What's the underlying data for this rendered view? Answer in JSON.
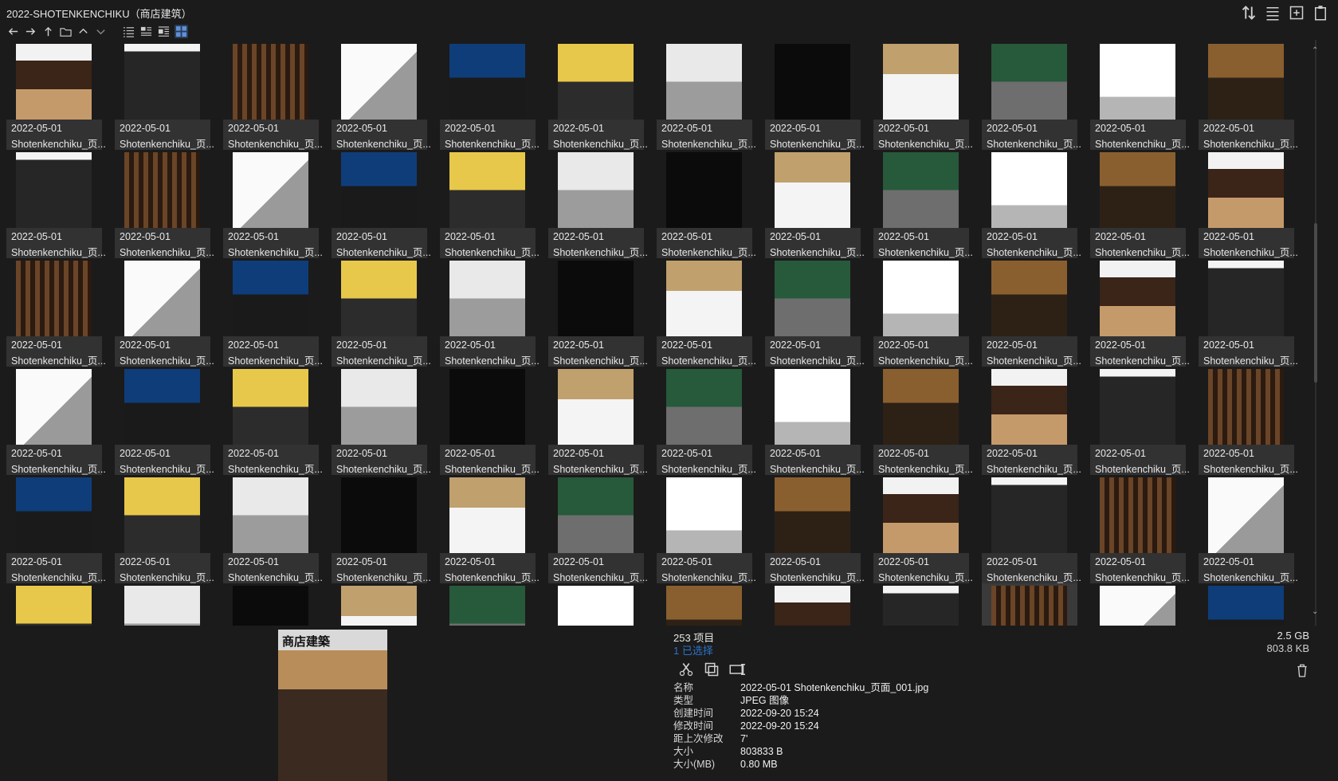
{
  "window": {
    "title": "2022-SHOTENKENCHIKU（商店建筑）"
  },
  "toolbar": {
    "nav": [
      {
        "name": "back-arrow-icon"
      },
      {
        "name": "forward-arrow-icon"
      },
      {
        "name": "up-arrow-icon"
      },
      {
        "name": "folder-icon"
      },
      {
        "name": "chevron-up-icon"
      },
      {
        "name": "chevron-down-icon"
      }
    ],
    "views": [
      {
        "name": "list-view-icon"
      },
      {
        "name": "detail-view-icon"
      },
      {
        "name": "details-pane-icon"
      },
      {
        "name": "grid-view-icon"
      }
    ],
    "active_view": "grid-view-icon"
  },
  "topright_icons": [
    "sort-icon",
    "columns-icon",
    "new-window-icon",
    "clipboard-icon"
  ],
  "grid": {
    "rows": 6,
    "cols": 12,
    "selected_index": 69,
    "cell_date": "2022-05-01",
    "cell_name": "Shotenkenchiku_页..."
  },
  "preview": {
    "cover_title": "商店建築"
  },
  "info": {
    "item_count": "253 项目",
    "selected_count": "1 已选择",
    "total_size": "2.5 GB",
    "selected_size": "803.8 KB",
    "actions": [
      "cut-icon",
      "copy-icon",
      "rename-icon"
    ],
    "props": [
      {
        "k": "名称",
        "v": "2022-05-01 Shotenkenchiku_页面_001.jpg"
      },
      {
        "k": "类型",
        "v": "JPEG 图像"
      },
      {
        "k": "创建时间",
        "v": "2022-09-20  15:24"
      },
      {
        "k": "修改时间",
        "v": "2022-09-20  15:24"
      },
      {
        "k": "距上次修改",
        "v": "7'"
      },
      {
        "k": "大小",
        "v": "803833 B"
      },
      {
        "k": "大小(MB)",
        "v": "0.80 MB"
      }
    ]
  }
}
